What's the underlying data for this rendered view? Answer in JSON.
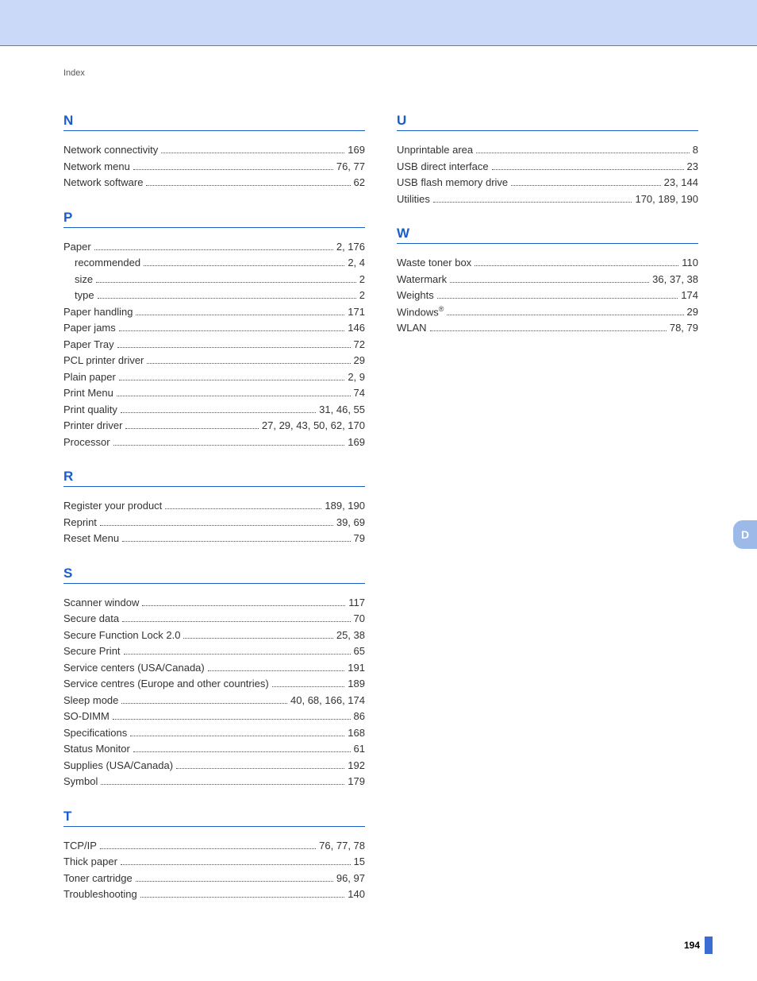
{
  "header_label": "Index",
  "side_tab": "D",
  "page_number": "194",
  "columns": [
    {
      "sections": [
        {
          "letter": "N",
          "entries": [
            {
              "term": "Network connectivity",
              "pages": "169"
            },
            {
              "term": "Network menu",
              "pages": "76, 77"
            },
            {
              "term": "Network software",
              "pages": "62"
            }
          ]
        },
        {
          "letter": "P",
          "entries": [
            {
              "term": "Paper",
              "pages": "2, 176"
            },
            {
              "term": "recommended",
              "pages": "2, 4",
              "sub": true
            },
            {
              "term": "size",
              "pages": "2",
              "sub": true
            },
            {
              "term": "type",
              "pages": "2",
              "sub": true
            },
            {
              "term": "Paper handling",
              "pages": "171"
            },
            {
              "term": "Paper jams",
              "pages": "146"
            },
            {
              "term": "Paper Tray",
              "pages": "72"
            },
            {
              "term": "PCL printer driver",
              "pages": "29"
            },
            {
              "term": "Plain paper",
              "pages": "2, 9"
            },
            {
              "term": "Print Menu",
              "pages": "74"
            },
            {
              "term": "Print quality",
              "pages": "31, 46, 55"
            },
            {
              "term": "Printer driver",
              "pages": "27, 29, 43, 50, 62, 170"
            },
            {
              "term": "Processor",
              "pages": "169"
            }
          ]
        },
        {
          "letter": "R",
          "entries": [
            {
              "term": "Register your product",
              "pages": "189, 190"
            },
            {
              "term": "Reprint",
              "pages": "39, 69"
            },
            {
              "term": "Reset Menu",
              "pages": "79"
            }
          ]
        },
        {
          "letter": "S",
          "entries": [
            {
              "term": "Scanner window",
              "pages": "117"
            },
            {
              "term": "Secure data",
              "pages": "70"
            },
            {
              "term": "Secure Function Lock 2.0",
              "pages": "25, 38"
            },
            {
              "term": "Secure Print",
              "pages": "65"
            },
            {
              "term": "Service centers (USA/Canada)",
              "pages": "191"
            },
            {
              "term": "Service centres (Europe and other countries)",
              "pages": "189"
            },
            {
              "term": "Sleep mode",
              "pages": "40, 68, 166, 174"
            },
            {
              "term": "SO-DIMM",
              "pages": "86"
            },
            {
              "term": "Specifications",
              "pages": "168"
            },
            {
              "term": "Status Monitor",
              "pages": "61"
            },
            {
              "term": "Supplies (USA/Canada)",
              "pages": "192"
            },
            {
              "term": "Symbol",
              "pages": "179"
            }
          ]
        },
        {
          "letter": "T",
          "entries": [
            {
              "term": "TCP/IP",
              "pages": "76, 77, 78"
            },
            {
              "term": "Thick paper",
              "pages": "15"
            },
            {
              "term": "Toner cartridge",
              "pages": "96, 97"
            },
            {
              "term": "Troubleshooting",
              "pages": "140"
            }
          ]
        }
      ]
    },
    {
      "sections": [
        {
          "letter": "U",
          "entries": [
            {
              "term": "Unprintable area",
              "pages": "8"
            },
            {
              "term": "USB direct interface",
              "pages": "23"
            },
            {
              "term": "USB flash memory drive",
              "pages": "23, 144"
            },
            {
              "term": "Utilities",
              "pages": "170, 189, 190"
            }
          ]
        },
        {
          "letter": "W",
          "entries": [
            {
              "term": "Waste toner box",
              "pages": "110"
            },
            {
              "term": "Watermark",
              "pages": "36, 37, 38"
            },
            {
              "term": "Weights",
              "pages": "174"
            },
            {
              "term": "Windows",
              "reg": true,
              "pages": "29"
            },
            {
              "term": "WLAN",
              "pages": "78, 79"
            }
          ]
        }
      ]
    }
  ]
}
